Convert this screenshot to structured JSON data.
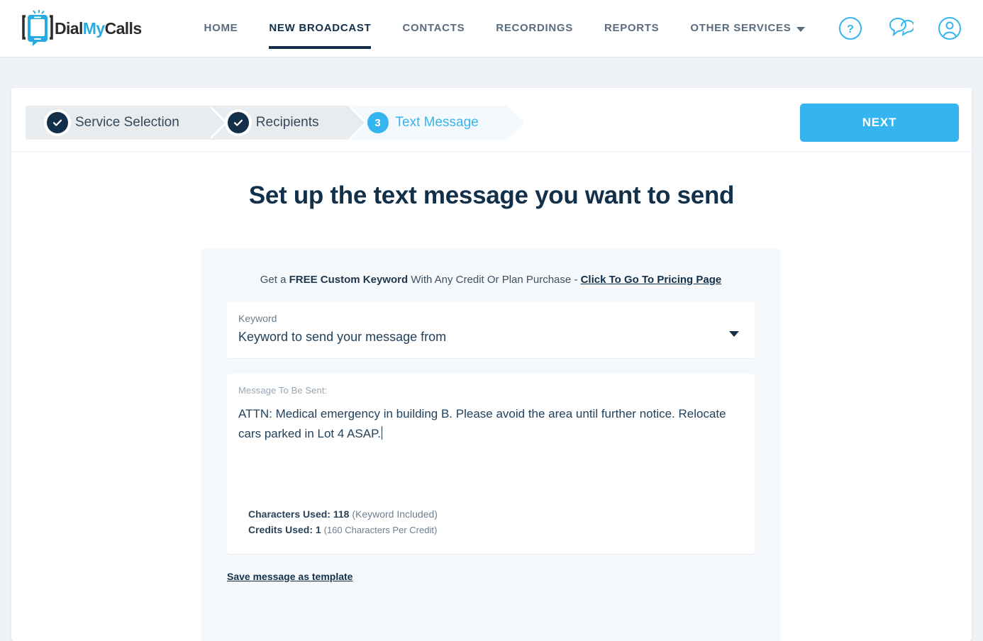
{
  "brand": {
    "name_part1": "Dial",
    "name_part2": "My",
    "name_part3": "Calls",
    "accent_color": "#29abe2",
    "dark_color": "#2b2b2b"
  },
  "nav": {
    "links": [
      {
        "label": "HOME",
        "active": false
      },
      {
        "label": "NEW BROADCAST",
        "active": true
      },
      {
        "label": "CONTACTS",
        "active": false
      },
      {
        "label": "RECORDINGS",
        "active": false
      },
      {
        "label": "REPORTS",
        "active": false
      },
      {
        "label": "OTHER SERVICES",
        "active": false,
        "has_caret": true
      }
    ],
    "icons": [
      "help-icon",
      "chat-icon",
      "account-icon"
    ]
  },
  "steps": [
    {
      "label": "Service Selection",
      "state": "done",
      "badge": "check"
    },
    {
      "label": "Recipients",
      "state": "done",
      "badge": "check"
    },
    {
      "label": "Text Message",
      "state": "current",
      "badge": "3"
    }
  ],
  "toolbar": {
    "next_label": "NEXT",
    "next_color": "#35b5ef"
  },
  "main": {
    "title": "Set up the text message you want to send",
    "promo": {
      "prefix": "Get a ",
      "bold": "FREE Custom Keyword",
      "middle": " With Any Credit Or Plan Purchase - ",
      "link": "Click To Go To Pricing Page"
    },
    "keyword_field": {
      "label": "Keyword",
      "value": "Keyword to send your message from",
      "caret": "chevron-down-icon"
    },
    "message_field": {
      "label": "Message To Be Sent:",
      "value": "ATTN: Medical emergency in building B. Please avoid the area until further notice. Relocate cars parked in Lot 4 ASAP."
    },
    "counters": {
      "characters_label": "Characters Used:",
      "characters_value": "118",
      "characters_note": "(Keyword Included)",
      "credits_label": "Credits Used:",
      "credits_value": "1",
      "credits_note": "(160 Characters Per Credit)"
    },
    "save_template_link": "Save message as template"
  }
}
